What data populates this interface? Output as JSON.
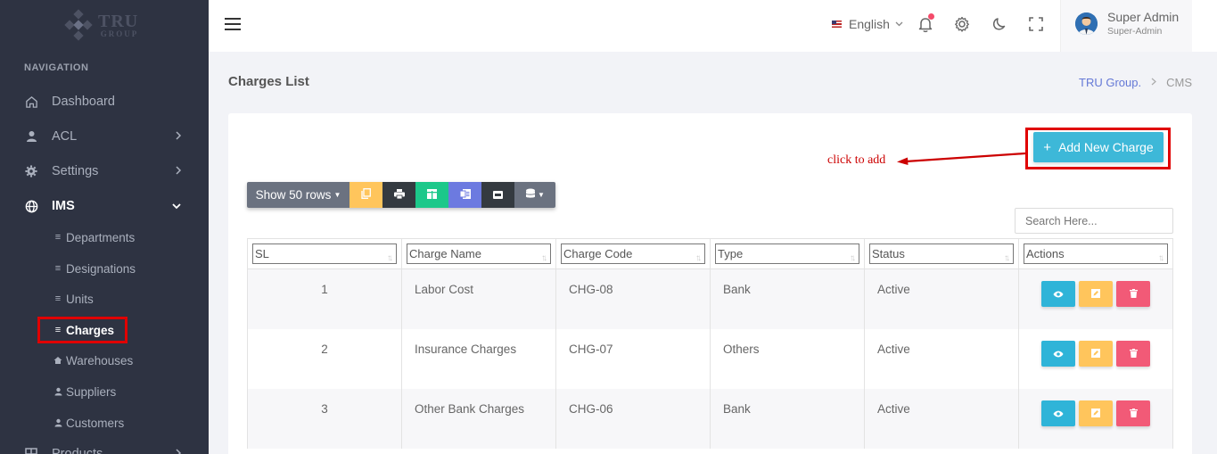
{
  "brand": {
    "name": "TRU",
    "sub": "GROUP"
  },
  "sidebar": {
    "heading": "NAVIGATION",
    "items": [
      {
        "label": "Dashboard",
        "icon": "home-icon"
      },
      {
        "label": "ACL",
        "icon": "user-icon",
        "chevron": ">"
      },
      {
        "label": "Settings",
        "icon": "gear-icon",
        "chevron": ">"
      },
      {
        "label": "IMS",
        "icon": "globe-icon",
        "chevron": "v"
      },
      {
        "label": "Products",
        "icon": "grid-icon",
        "chevron": ">"
      }
    ],
    "subitems": [
      {
        "label": "Departments",
        "icon": "list-icon"
      },
      {
        "label": "Designations",
        "icon": "list-icon"
      },
      {
        "label": "Units",
        "icon": "list-icon"
      },
      {
        "label": "Charges",
        "icon": "list-icon"
      },
      {
        "label": "Warehouses",
        "icon": "home-icon"
      },
      {
        "label": "Suppliers",
        "icon": "user-icon"
      },
      {
        "label": "Customers",
        "icon": "user-icon"
      }
    ]
  },
  "header": {
    "language": "English",
    "user_name": "Super Admin",
    "user_role": "Super-Admin"
  },
  "page": {
    "title": "Charges List",
    "breadcrumb": {
      "parent": "TRU Group.",
      "current": "CMS"
    }
  },
  "actions": {
    "add_label": "Add New Charge",
    "annotation": "click to add"
  },
  "toolbar": {
    "show_rows": "Show 50 rows",
    "buttons": [
      {
        "name": "copy",
        "color": "#ffc55c"
      },
      {
        "name": "print",
        "color": "#343a40"
      },
      {
        "name": "excel",
        "color": "#1cc88a"
      },
      {
        "name": "csv",
        "color": "#6c7ae0"
      },
      {
        "name": "pdf",
        "color": "#343a40"
      },
      {
        "name": "columns",
        "color": "#6b7280"
      }
    ]
  },
  "search": {
    "placeholder": "Search Here..."
  },
  "table": {
    "columns": [
      "SL",
      "Charge Name",
      "Charge Code",
      "Type",
      "Status",
      "Actions"
    ],
    "rows": [
      {
        "sl": "1",
        "name": "Labor Cost",
        "code": "CHG-08",
        "type": "Bank",
        "status": "Active"
      },
      {
        "sl": "2",
        "name": "Insurance Charges",
        "code": "CHG-07",
        "type": "Others",
        "status": "Active"
      },
      {
        "sl": "3",
        "name": "Other Bank Charges",
        "code": "CHG-06",
        "type": "Bank",
        "status": "Active"
      }
    ]
  },
  "colors": {
    "sidebar_bg": "#2e3342",
    "accent": "#3db8d8",
    "highlight": "#e00000"
  }
}
